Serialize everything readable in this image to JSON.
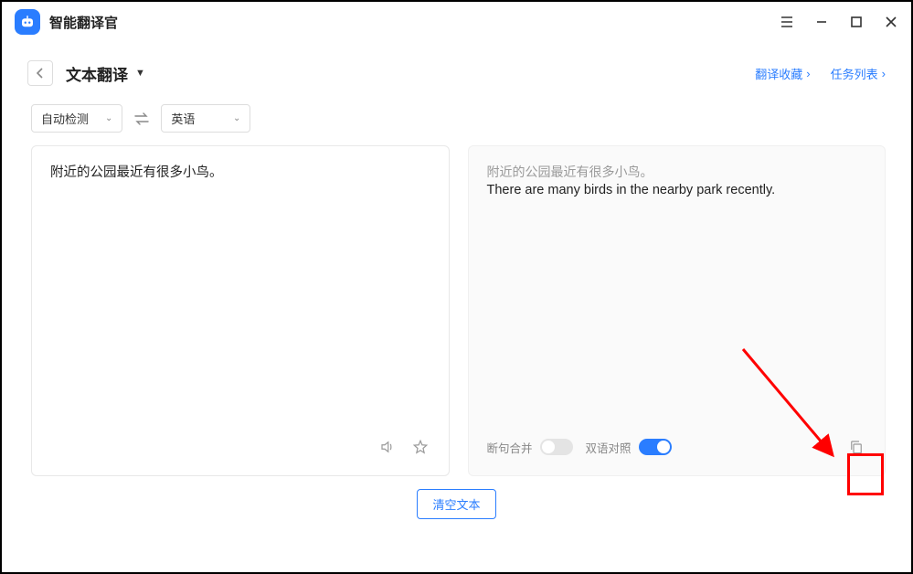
{
  "app": {
    "title": "智能翻译官"
  },
  "toolbar": {
    "mode_label": "文本翻译",
    "favorites_label": "翻译收藏",
    "tasks_label": "任务列表"
  },
  "lang": {
    "source": "自动检测",
    "target": "英语"
  },
  "input": {
    "text": "附近的公园最近有很多小鸟。"
  },
  "output": {
    "source_echo": "附近的公园最近有很多小鸟。",
    "translation": "There are many birds in the nearby park recently."
  },
  "controls": {
    "segment_merge_label": "断句合并",
    "bilingual_label": "双语对照",
    "clear_label": "清空文本",
    "segment_merge_on": false,
    "bilingual_on": true
  },
  "icons": {
    "back": "chevron-left-icon",
    "swap": "swap-icon",
    "speaker": "speaker-icon",
    "star": "star-icon",
    "copy": "copy-icon",
    "menu": "hamburger-icon",
    "minimize": "minimize-icon",
    "maximize": "maximize-icon",
    "close": "close-icon"
  }
}
